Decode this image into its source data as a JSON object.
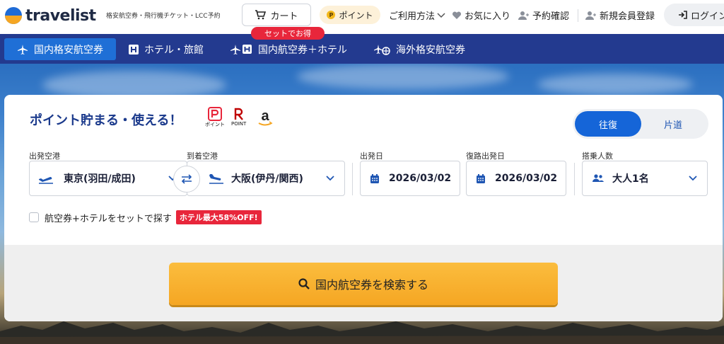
{
  "header": {
    "logo_text": "travelist",
    "tagline": "格安航空券・飛行機チケット・LCC予約",
    "cart_label": "カート",
    "set_badge": "セットでお得",
    "point_label": "ポイント",
    "usage_label": "ご利用方法",
    "favorites_label": "お気に入り",
    "booking_label": "予約確認",
    "register_label": "新規会員登録",
    "login_label": "ログイン"
  },
  "tabs": [
    {
      "label": "国内格安航空券",
      "icon": "airplane-icon"
    },
    {
      "label": "ホテル・旅館",
      "icon": "hotel-icon"
    },
    {
      "label": "国内航空券＋ホテル",
      "icon": "plane-hotel-icon"
    },
    {
      "label": "海外格安航空券",
      "icon": "plane-globe-icon"
    }
  ],
  "search": {
    "promo_title": "ポイント貯まる・使える！",
    "paypay_caption": "ポイント",
    "rakuten_caption": "POINT",
    "trip_roundtrip": "往復",
    "trip_oneway": "片道",
    "departure_label": "出発空港",
    "departure_value": "東京(羽田/成田)",
    "arrival_label": "到着空港",
    "arrival_value": "大阪(伊丹/関西)",
    "depart_date_label": "出発日",
    "depart_date_value": "2026/03/02",
    "return_date_label": "復路出発日",
    "return_date_value": "2026/03/02",
    "passengers_label": "搭乗人数",
    "passengers_value": "大人1名",
    "combo_label": "航空券+ホテルをセットで探す",
    "combo_badge": "ホテル最大58%OFF!",
    "search_button": "国内航空券を検索する"
  },
  "colors": {
    "nav_bg": "#233a8f",
    "tab_active": "#1f6fd6",
    "accent_blue": "#1565d8",
    "badge_red": "#e8263b",
    "search_button": "#f5a623"
  }
}
